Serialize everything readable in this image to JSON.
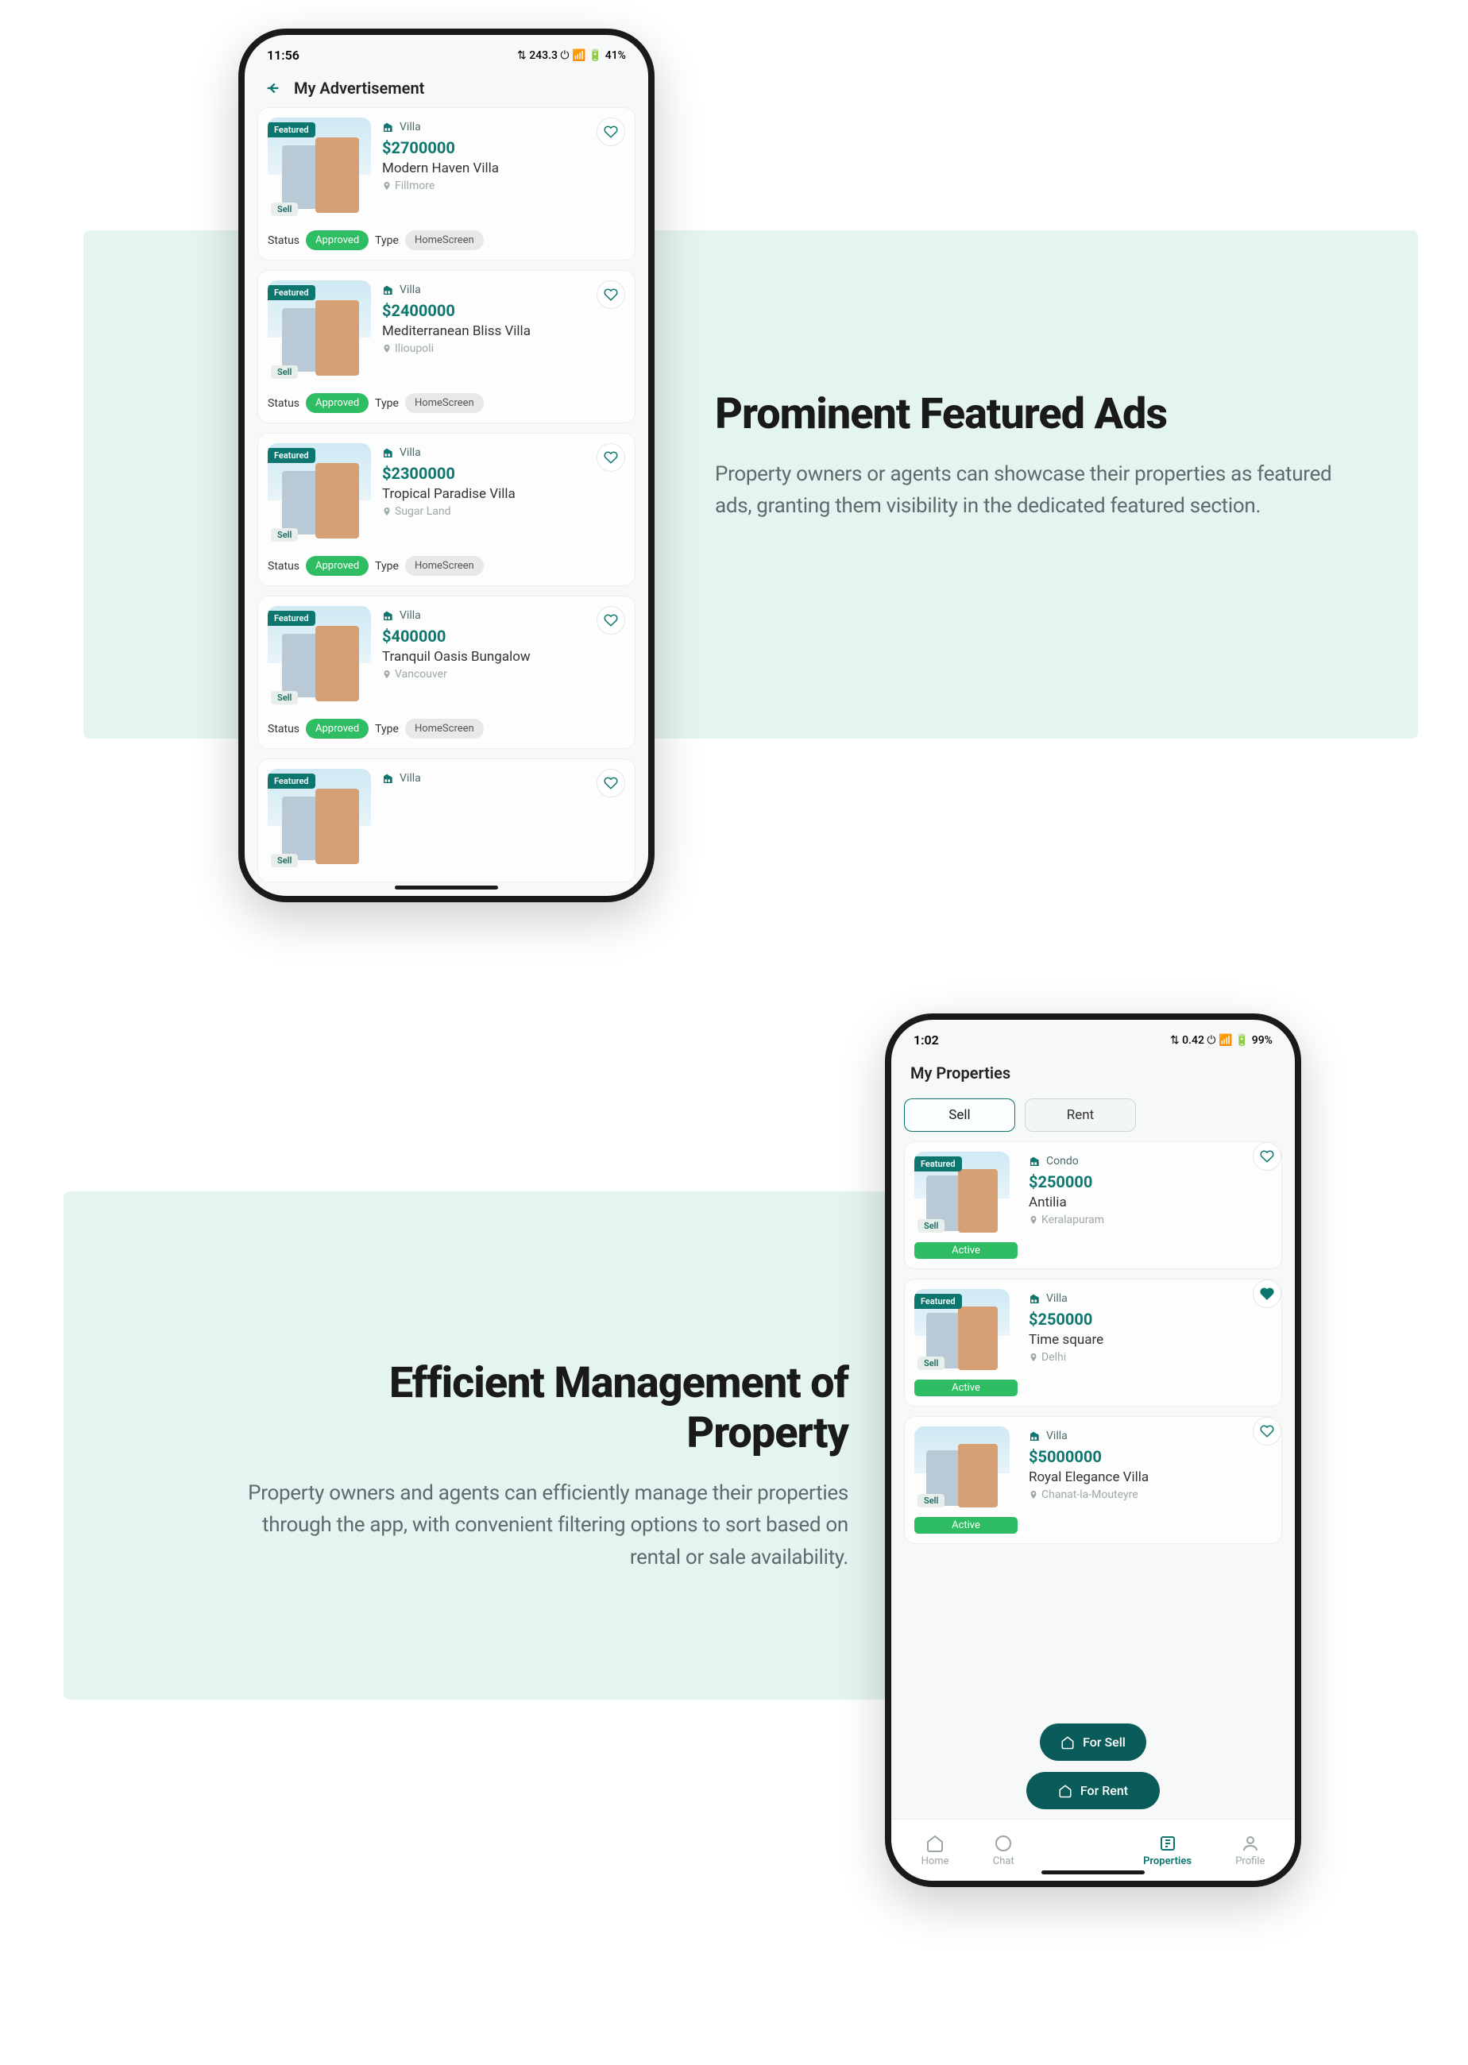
{
  "section1": {
    "heading": "Prominent Featured Ads",
    "body": "Property owners or agents can showcase their properties as featured ads, granting them visibility in the dedicated featured section.",
    "statusbar": {
      "time": "11:56",
      "right": "⇅ 243.3  ⏻  📶  🔋 41%"
    },
    "header": {
      "title": "My Advertisement"
    },
    "labels": {
      "status": "Status",
      "type": "Type",
      "approved": "Approved",
      "homescreen": "HomeScreen",
      "featured": "Featured",
      "sell": "Sell"
    },
    "items": [
      {
        "category": "Villa",
        "price": "$2700000",
        "title": "Modern Haven Villa",
        "location": "Fillmore"
      },
      {
        "category": "Villa",
        "price": "$2400000",
        "title": "Mediterranean Bliss Villa",
        "location": "Ilioupoli"
      },
      {
        "category": "Villa",
        "price": "$2300000",
        "title": "Tropical Paradise Villa",
        "location": "Sugar Land"
      },
      {
        "category": "Villa",
        "price": "$400000",
        "title": "Tranquil Oasis Bungalow",
        "location": "Vancouver"
      },
      {
        "category": "Villa",
        "price": "",
        "title": "",
        "location": ""
      }
    ]
  },
  "section2": {
    "heading": "Efficient Management of Property",
    "body": "Property owners and agents can efficiently manage their properties through the app, with convenient filtering options to sort based on rental or sale availability.",
    "statusbar": {
      "time": "1:02",
      "right": "⇅ 0.42  ⏻  📶  🔋 99%"
    },
    "header": {
      "title": "My Properties"
    },
    "tabs": {
      "sell": "Sell",
      "rent": "Rent"
    },
    "labels": {
      "featured": "Featured",
      "sell": "Sell",
      "active": "Active"
    },
    "items": [
      {
        "category": "Condo",
        "price": "$250000",
        "title": "Antilia",
        "location": "Keralapuram",
        "featured": true,
        "liked": false
      },
      {
        "category": "Villa",
        "price": "$250000",
        "title": "Time square",
        "location": "Delhi",
        "featured": true,
        "liked": true
      },
      {
        "category": "Villa",
        "price": "$5000000",
        "title": "Royal Elegance Villa",
        "location": "Chanat-la-Mouteyre",
        "featured": false,
        "liked": false
      }
    ],
    "fab": {
      "forSell": "For Sell",
      "forRent": "For Rent",
      "close": "✕"
    },
    "nav": {
      "home": "Home",
      "chat": "Chat",
      "properties": "Properties",
      "profile": "Profile"
    }
  }
}
